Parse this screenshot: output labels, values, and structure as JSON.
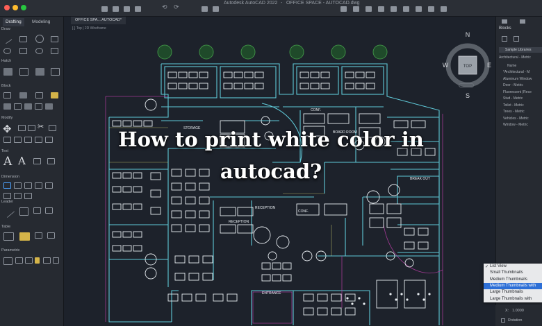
{
  "window": {
    "app_title": "Autodesk AutoCAD 2022",
    "file_title": "OFFICE SPACE - AUTOCAD.dwg"
  },
  "ribbon": {
    "tabs": [
      "Drafting",
      "Modeling"
    ],
    "sections": [
      "Draw",
      "Hatch",
      "Block",
      "Modify",
      "Text",
      "Dimension",
      "Leader",
      "Table",
      "Parametric"
    ]
  },
  "canvas": {
    "doc_tab": "OFFICE SPA... AUTOCAD*",
    "view_label": "[-] Top | 2D Wireframe"
  },
  "viewcube": {
    "north": "N",
    "south": "S",
    "east": "E",
    "west": "W",
    "top": "TOP"
  },
  "drawing_labels": {
    "storage": "STORAGE",
    "reception": "RECEPTION",
    "reception2": "RECEPTION",
    "break_out": "BREAK OUT",
    "entrance": "ENTRANCE",
    "board_room": "BOARD ROOM",
    "conf": "CONF.",
    "conf2": "CONF."
  },
  "overlay": {
    "line1": "How to print white color in",
    "line2": "autocad?"
  },
  "blocks_panel": {
    "title": "Blocks",
    "library": "Sample Libraries",
    "library_path": "Architectural - Metric",
    "name_header": "Name",
    "items": [
      "*Architectural - M",
      "Aluminum Window",
      "Door - Metric",
      "Fluorescent (Rece",
      "Stud - Metric",
      "Toilet - Metric",
      "Trees - Metric",
      "Vehicles - Metric",
      "Window - Metric"
    ]
  },
  "view_menu": {
    "items": [
      "List View",
      "Small Thumbnails",
      "Medium Thumbnails",
      "Medium Thumbnails with",
      "Large Thumbnails",
      "Large Thumbnails with"
    ],
    "checked_index": 0,
    "selected_index": 3
  },
  "status": {
    "scale_label": "X:",
    "scale_value": "1.0000",
    "rotation_label": "Rotation"
  },
  "colors": {
    "walls": "#5fc9d8",
    "walls_alt": "#e3e07a",
    "furniture": "#e9eef2",
    "trees": "#3f8f46",
    "accent_magenta": "#c23fae",
    "selection_blue": "#2d6fd6"
  }
}
